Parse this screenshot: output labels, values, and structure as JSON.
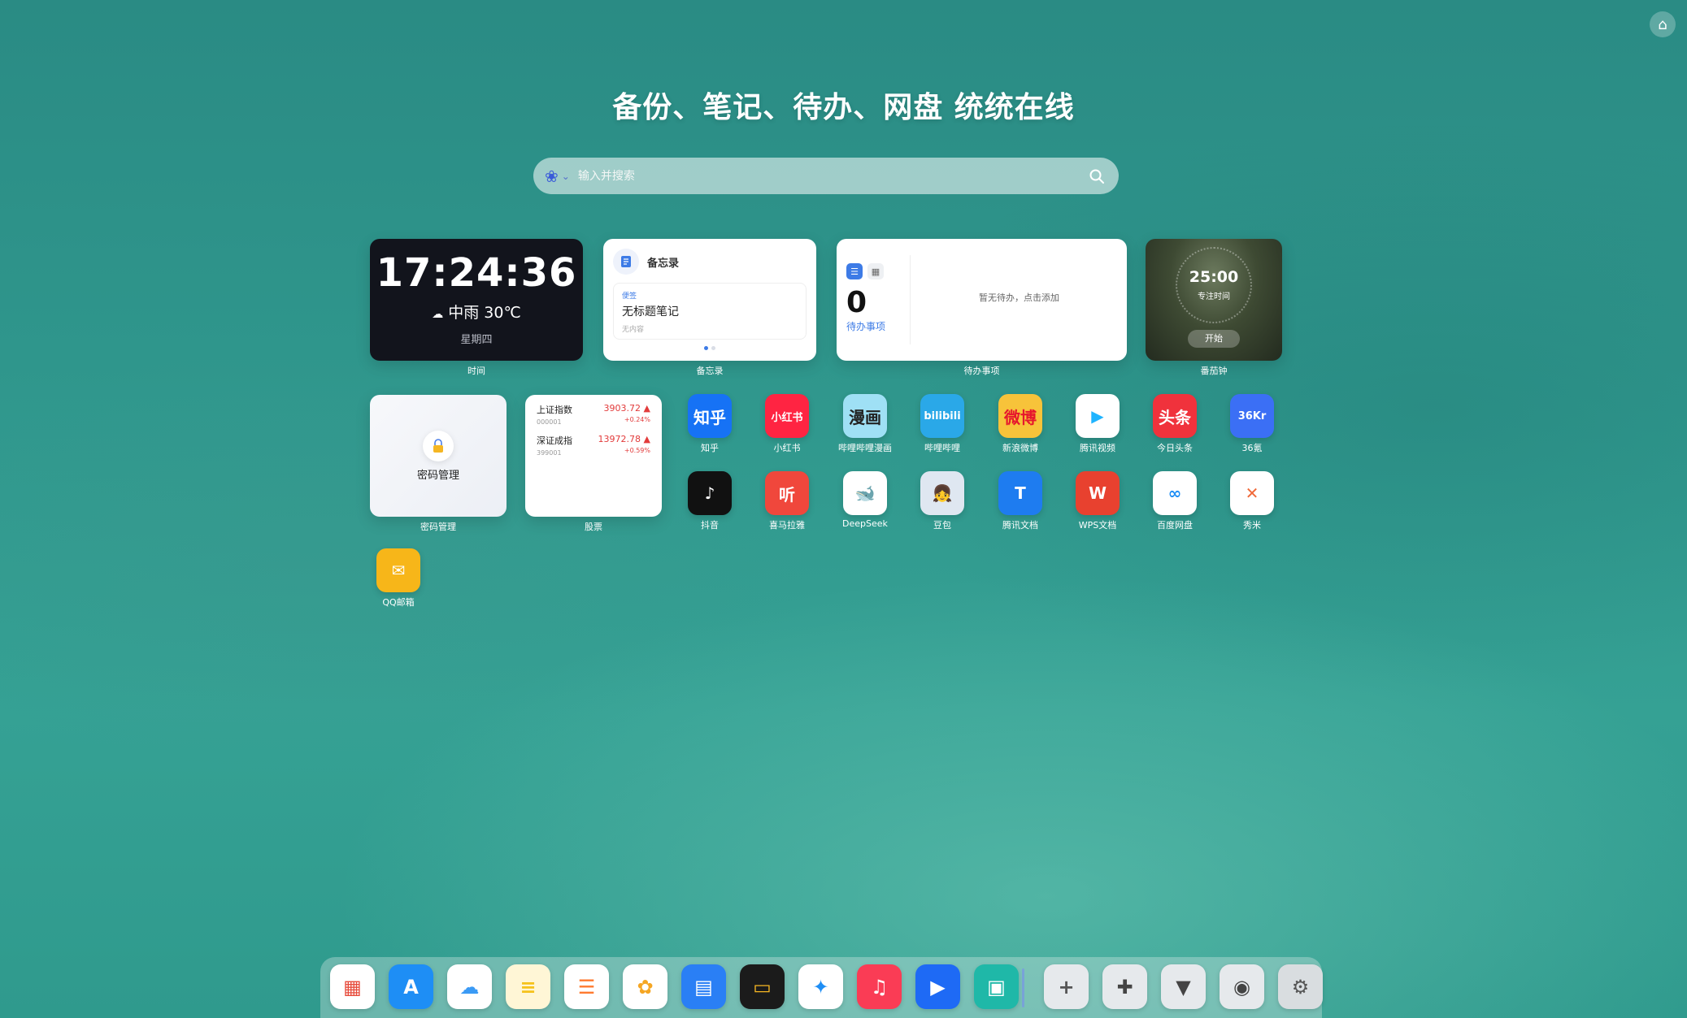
{
  "headline": "备份、笔记、待办、网盘 统统在线",
  "search": {
    "placeholder": "输入并搜索"
  },
  "clock": {
    "time": "17:24:36",
    "weather": "中雨 30℃",
    "weekday": "星期四",
    "caption": "时间"
  },
  "memo": {
    "title": "备忘录",
    "tag": "便签",
    "note_title": "无标题笔记",
    "note_sub": "无内容",
    "caption": "备忘录"
  },
  "todo": {
    "count": "0",
    "label": "待办事项",
    "empty": "暂无待办，点击添加",
    "caption": "待办事项"
  },
  "pomodoro": {
    "time": "25:00",
    "label": "专注时间",
    "start": "开始",
    "caption": "番茄钟"
  },
  "password": {
    "label": "密码管理",
    "caption": "密码管理"
  },
  "stocks": {
    "caption": "股票",
    "rows": [
      {
        "name": "上证指数",
        "code": "000001",
        "value": "3903.72 ▲",
        "change": "+0.24%"
      },
      {
        "name": "深证成指",
        "code": "399001",
        "value": "13972.78 ▲",
        "change": "+0.59%"
      }
    ]
  },
  "apps": [
    {
      "label": "知乎",
      "glyph": "知乎",
      "bg": "#1672f5",
      "fg": "#ffffff"
    },
    {
      "label": "小红书",
      "glyph": "小红书",
      "bg": "#ff2442",
      "fg": "#ffffff"
    },
    {
      "label": "哔哩哔哩漫画",
      "glyph": "漫画",
      "bg": "#9fe0f5",
      "fg": "#222222"
    },
    {
      "label": "哔哩哔哩",
      "glyph": "bilibili",
      "bg": "#2aa8e8",
      "fg": "#ffffff"
    },
    {
      "label": "新浪微博",
      "glyph": "微博",
      "bg": "#f7c33a",
      "fg": "#e6162d"
    },
    {
      "label": "腾讯视频",
      "glyph": "▶",
      "bg": "#ffffff",
      "fg": "#1fb4ff"
    },
    {
      "label": "今日头条",
      "glyph": "头条",
      "bg": "#f0323c",
      "fg": "#ffffff"
    },
    {
      "label": "36氪",
      "glyph": "36Kr",
      "bg": "#3b6ff5",
      "fg": "#ffffff"
    },
    {
      "label": "抖音",
      "glyph": "♪",
      "bg": "#111111",
      "fg": "#ffffff"
    },
    {
      "label": "喜马拉雅",
      "glyph": "听",
      "bg": "#f0473c",
      "fg": "#ffffff"
    },
    {
      "label": "DeepSeek",
      "glyph": "🐋",
      "bg": "#ffffff",
      "fg": "#4d6bfe"
    },
    {
      "label": "豆包",
      "glyph": "👧",
      "bg": "#dfe7f1",
      "fg": "#333333"
    },
    {
      "label": "腾讯文档",
      "glyph": "T",
      "bg": "#1e7cf0",
      "fg": "#ffffff"
    },
    {
      "label": "WPS文档",
      "glyph": "W",
      "bg": "#e8412f",
      "fg": "#ffffff"
    },
    {
      "label": "百度网盘",
      "glyph": "∞",
      "bg": "#ffffff",
      "fg": "#1e8ef5"
    },
    {
      "label": "秀米",
      "glyph": "✕",
      "bg": "#ffffff",
      "fg": "#f06a3a"
    },
    {
      "label": "QQ邮箱",
      "glyph": "✉",
      "bg": "#f7b619",
      "fg": "#ffffff"
    }
  ],
  "dock": [
    {
      "name": "launchpad",
      "glyph": "▦",
      "bg": "#ffffff",
      "fg": "#e74c3c"
    },
    {
      "name": "app-store",
      "glyph": "A",
      "bg": "#1e8ef5",
      "fg": "#ffffff"
    },
    {
      "name": "icloud",
      "glyph": "☁",
      "bg": "#ffffff",
      "fg": "#3a9af5"
    },
    {
      "name": "notes",
      "glyph": "≡",
      "bg": "#fff6d6",
      "fg": "#f5c21b"
    },
    {
      "name": "reminders",
      "glyph": "☰",
      "bg": "#ffffff",
      "fg": "#ff7a2f"
    },
    {
      "name": "photos",
      "glyph": "✿",
      "bg": "#ffffff",
      "fg": "#f5a623"
    },
    {
      "name": "files",
      "glyph": "▤",
      "bg": "#2a7ff5",
      "fg": "#ffffff"
    },
    {
      "name": "wallet",
      "glyph": "▭",
      "bg": "#1b1b1b",
      "fg": "#f5b623"
    },
    {
      "name": "safari",
      "glyph": "✦",
      "bg": "#ffffff",
      "fg": "#1e8ef5"
    },
    {
      "name": "music",
      "glyph": "♫",
      "bg": "#fa3c55",
      "fg": "#ffffff"
    },
    {
      "name": "video",
      "glyph": "▶",
      "bg": "#1e6af5",
      "fg": "#ffffff"
    },
    {
      "name": "qr-code",
      "glyph": "▣",
      "bg": "#1fb8a8",
      "fg": "#ffffff"
    },
    {
      "name": "add",
      "glyph": "+",
      "bg": "#e6e9ec",
      "fg": "#555555"
    },
    {
      "name": "plugins",
      "glyph": "✚",
      "bg": "#e6e9ec",
      "fg": "#444444"
    },
    {
      "name": "themes",
      "glyph": "▼",
      "bg": "#e6e9ec",
      "fg": "#444444"
    },
    {
      "name": "lock",
      "glyph": "◉",
      "bg": "#e6e9ec",
      "fg": "#444444"
    },
    {
      "name": "settings",
      "glyph": "⚙",
      "bg": "#d9dde0",
      "fg": "#555555"
    }
  ]
}
